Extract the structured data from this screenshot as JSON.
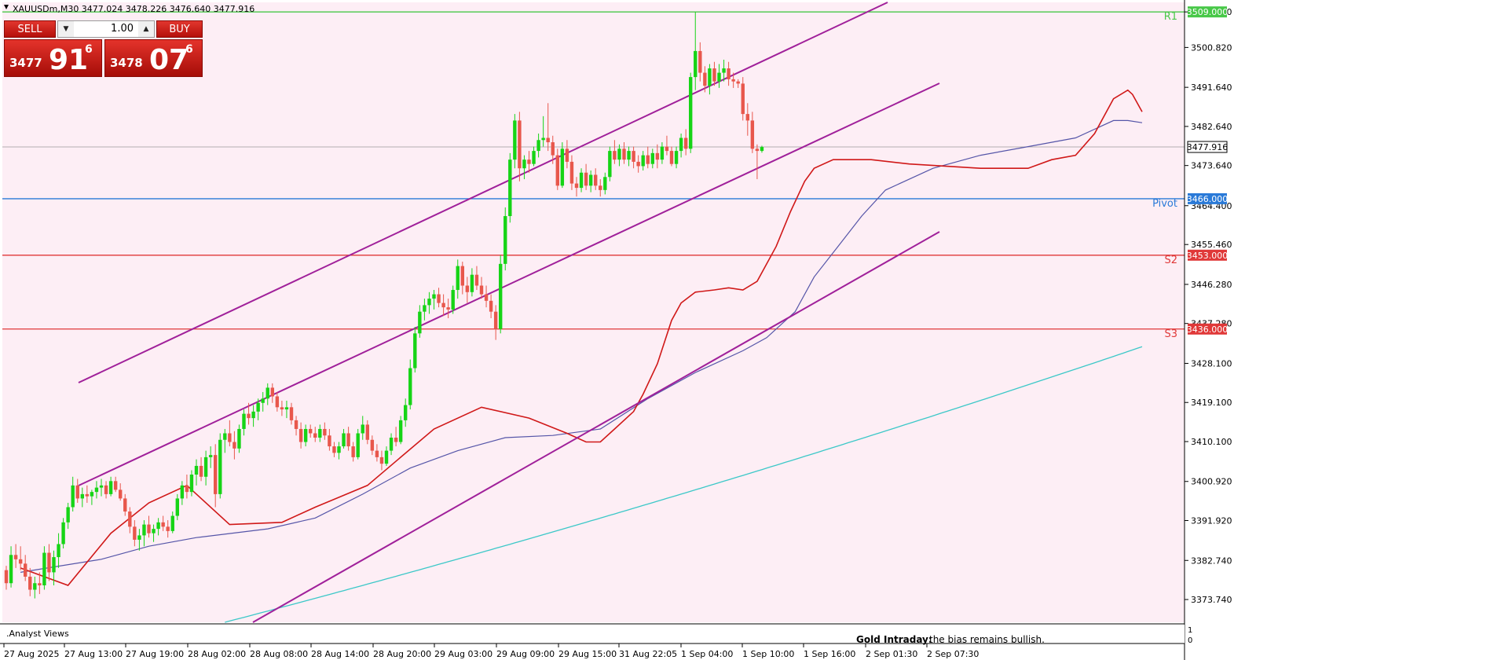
{
  "header": {
    "symbol_info": "XAUUSDm,M30  3477.024 3478.226 3476.640 3477.916"
  },
  "trade_panel": {
    "sell_label": "SELL",
    "buy_label": "BUY",
    "lot": "1.00",
    "sell_price_prefix": "3477",
    "sell_price_big": "91",
    "sell_price_sup": "6",
    "buy_price_prefix": "3478",
    "buy_price_big": "07",
    "buy_price_sup": "6"
  },
  "colors": {
    "background": "#fdeef5",
    "bull": "#16d416",
    "bear": "#e8574c",
    "channel": "#a0209a",
    "ma_fast": "#d01818",
    "ma_mid": "#5555a8",
    "ma_slow": "#3cc8c8",
    "r1": "#48c848",
    "pivot": "#2a7ad8",
    "support": "#e03838",
    "current": "#9a9a9a"
  },
  "chart_data": {
    "type": "candlestick",
    "symbol": "XAUUSDm",
    "timeframe": "M30",
    "ylim": [
      3368.5,
      3511.2
    ],
    "price_ticks": [
      "3509.000",
      "3500.820",
      "3491.640",
      "3482.640",
      "3473.640",
      "3464.400",
      "3455.460",
      "3446.280",
      "3437.280",
      "3428.100",
      "3419.100",
      "3410.100",
      "3400.920",
      "3391.920",
      "3382.740",
      "3373.740"
    ],
    "time_labels": [
      "27 Aug 2025",
      "27 Aug 13:00",
      "27 Aug 19:00",
      "28 Aug 02:00",
      "28 Aug 08:00",
      "28 Aug 14:00",
      "28 Aug 20:00",
      "29 Aug 03:00",
      "29 Aug 09:00",
      "29 Aug 15:00",
      "31 Aug 22:05",
      "1 Sep 04:00",
      "1 Sep 10:00",
      "1 Sep 16:00",
      "2 Sep 01:30",
      "2 Sep 07:30"
    ],
    "levels": [
      {
        "name": "R1",
        "value": 3509.0,
        "label": "3509.000"
      },
      {
        "name": "Pivot",
        "value": 3466.0,
        "label": "3466.000"
      },
      {
        "name": "S2",
        "value": 3453.0,
        "label": "3453.000"
      },
      {
        "name": "S3",
        "value": 3436.0,
        "label": "3436.000"
      }
    ],
    "current_price": {
      "value": 3477.916,
      "label": "3477.916"
    },
    "candles": [
      [
        3380.5,
        3381.5,
        3376.0,
        3377.5
      ],
      [
        3377.5,
        3386.0,
        3376.5,
        3384.0
      ],
      [
        3384.0,
        3386.5,
        3381.0,
        3383.0
      ],
      [
        3383.0,
        3386.0,
        3380.5,
        3382.0
      ],
      [
        3382.0,
        3384.0,
        3378.0,
        3379.0
      ],
      [
        3379.0,
        3381.0,
        3374.5,
        3376.0
      ],
      [
        3376.0,
        3379.0,
        3374.0,
        3377.5
      ],
      [
        3377.5,
        3380.0,
        3375.0,
        3377.0
      ],
      [
        3377.0,
        3386.0,
        3376.0,
        3384.5
      ],
      [
        3384.5,
        3386.5,
        3378.0,
        3380.0
      ],
      [
        3380.0,
        3385.0,
        3377.0,
        3383.5
      ],
      [
        3383.5,
        3389.0,
        3381.0,
        3386.5
      ],
      [
        3386.5,
        3392.5,
        3385.5,
        3391.5
      ],
      [
        3391.5,
        3396.0,
        3390.0,
        3395.0
      ],
      [
        3395.0,
        3402.0,
        3394.0,
        3400.0
      ],
      [
        3400.0,
        3401.5,
        3396.0,
        3397.0
      ],
      [
        3397.0,
        3399.5,
        3395.0,
        3398.0
      ],
      [
        3398.0,
        3400.0,
        3396.0,
        3397.5
      ],
      [
        3397.5,
        3399.0,
        3395.5,
        3398.5
      ],
      [
        3398.5,
        3401.0,
        3397.0,
        3399.5
      ],
      [
        3399.5,
        3401.5,
        3397.5,
        3400.0
      ],
      [
        3400.0,
        3401.0,
        3397.0,
        3398.0
      ],
      [
        3398.0,
        3402.0,
        3397.5,
        3401.0
      ],
      [
        3401.0,
        3402.0,
        3398.5,
        3399.0
      ],
      [
        3399.0,
        3400.5,
        3396.5,
        3397.0
      ],
      [
        3397.0,
        3398.0,
        3393.0,
        3394.0
      ],
      [
        3394.0,
        3395.0,
        3389.0,
        3390.5
      ],
      [
        3390.5,
        3392.0,
        3386.0,
        3387.5
      ],
      [
        3387.5,
        3390.0,
        3385.0,
        3388.5
      ],
      [
        3388.5,
        3392.0,
        3386.0,
        3391.0
      ],
      [
        3391.0,
        3393.0,
        3388.0,
        3389.0
      ],
      [
        3389.0,
        3391.0,
        3387.0,
        3390.0
      ],
      [
        3390.0,
        3392.5,
        3388.5,
        3391.5
      ],
      [
        3391.5,
        3393.0,
        3389.5,
        3390.5
      ],
      [
        3390.5,
        3392.0,
        3388.0,
        3389.5
      ],
      [
        3389.5,
        3394.0,
        3389.0,
        3393.0
      ],
      [
        3393.0,
        3398.0,
        3392.0,
        3397.0
      ],
      [
        3397.0,
        3401.0,
        3395.5,
        3400.0
      ],
      [
        3400.0,
        3402.5,
        3397.0,
        3398.5
      ],
      [
        3398.5,
        3403.5,
        3397.5,
        3402.5
      ],
      [
        3402.5,
        3406.0,
        3400.0,
        3404.5
      ],
      [
        3404.5,
        3406.5,
        3401.0,
        3402.0
      ],
      [
        3402.0,
        3408.0,
        3400.0,
        3406.5
      ],
      [
        3406.5,
        3409.0,
        3404.0,
        3407.0
      ],
      [
        3407.0,
        3409.5,
        3395.0,
        3398.0
      ],
      [
        3398.0,
        3412.0,
        3397.0,
        3410.5
      ],
      [
        3410.5,
        3413.0,
        3407.5,
        3412.0
      ],
      [
        3412.0,
        3415.0,
        3409.0,
        3410.0
      ],
      [
        3410.0,
        3412.5,
        3406.0,
        3408.5
      ],
      [
        3408.5,
        3414.0,
        3407.5,
        3413.0
      ],
      [
        3413.0,
        3417.5,
        3411.5,
        3416.5
      ],
      [
        3416.5,
        3419.0,
        3414.0,
        3415.5
      ],
      [
        3415.5,
        3418.5,
        3413.5,
        3417.0
      ],
      [
        3417.0,
        3420.0,
        3415.0,
        3419.0
      ],
      [
        3419.0,
        3421.5,
        3417.0,
        3420.0
      ],
      [
        3420.0,
        3423.5,
        3418.5,
        3422.5
      ],
      [
        3422.5,
        3423.5,
        3419.0,
        3420.5
      ],
      [
        3420.5,
        3421.5,
        3417.0,
        3418.0
      ],
      [
        3418.0,
        3419.5,
        3416.0,
        3417.5
      ],
      [
        3417.5,
        3419.5,
        3415.5,
        3418.0
      ],
      [
        3418.0,
        3419.0,
        3414.0,
        3415.0
      ],
      [
        3415.0,
        3416.0,
        3411.5,
        3413.0
      ],
      [
        3413.0,
        3414.5,
        3408.5,
        3410.0
      ],
      [
        3410.0,
        3414.0,
        3409.0,
        3413.0
      ],
      [
        3413.0,
        3414.0,
        3411.0,
        3412.0
      ],
      [
        3412.0,
        3413.5,
        3410.0,
        3411.0
      ],
      [
        3411.0,
        3414.0,
        3410.0,
        3413.0
      ],
      [
        3413.0,
        3414.5,
        3410.5,
        3411.5
      ],
      [
        3411.5,
        3413.0,
        3408.0,
        3409.0
      ],
      [
        3409.0,
        3410.0,
        3406.5,
        3407.5
      ],
      [
        3407.5,
        3410.0,
        3406.0,
        3409.0
      ],
      [
        3409.0,
        3413.0,
        3408.5,
        3412.0
      ],
      [
        3412.0,
        3413.5,
        3408.0,
        3409.0
      ],
      [
        3409.0,
        3410.0,
        3405.5,
        3406.5
      ],
      [
        3406.5,
        3413.0,
        3406.0,
        3412.0
      ],
      [
        3412.0,
        3416.0,
        3410.5,
        3414.0
      ],
      [
        3414.0,
        3415.0,
        3409.5,
        3410.5
      ],
      [
        3410.5,
        3411.5,
        3407.0,
        3408.0
      ],
      [
        3408.0,
        3409.5,
        3405.5,
        3406.5
      ],
      [
        3406.5,
        3408.0,
        3403.5,
        3405.0
      ],
      [
        3405.0,
        3409.0,
        3404.5,
        3408.0
      ],
      [
        3408.0,
        3412.0,
        3407.0,
        3411.0
      ],
      [
        3411.0,
        3413.5,
        3409.0,
        3410.0
      ],
      [
        3410.0,
        3416.0,
        3409.5,
        3415.0
      ],
      [
        3415.0,
        3420.0,
        3413.5,
        3418.5
      ],
      [
        3418.5,
        3429.0,
        3417.5,
        3427.0
      ],
      [
        3427.0,
        3436.5,
        3426.0,
        3435.0
      ],
      [
        3435.0,
        3441.5,
        3434.0,
        3440.0
      ],
      [
        3440.0,
        3443.0,
        3438.0,
        3441.5
      ],
      [
        3441.5,
        3444.5,
        3439.5,
        3443.0
      ],
      [
        3443.0,
        3445.0,
        3440.5,
        3444.0
      ],
      [
        3444.0,
        3445.5,
        3441.0,
        3442.0
      ],
      [
        3442.0,
        3444.0,
        3439.0,
        3441.0
      ],
      [
        3441.0,
        3443.0,
        3438.5,
        3440.5
      ],
      [
        3440.5,
        3446.0,
        3439.5,
        3445.0
      ],
      [
        3445.0,
        3452.0,
        3443.0,
        3450.5
      ],
      [
        3450.5,
        3451.5,
        3444.0,
        3446.0
      ],
      [
        3446.0,
        3448.0,
        3442.0,
        3444.5
      ],
      [
        3444.5,
        3450.0,
        3443.5,
        3448.5
      ],
      [
        3448.5,
        3450.5,
        3445.0,
        3446.0
      ],
      [
        3446.0,
        3448.0,
        3443.0,
        3444.0
      ],
      [
        3444.0,
        3446.0,
        3441.0,
        3442.5
      ],
      [
        3442.5,
        3444.0,
        3438.5,
        3440.0
      ],
      [
        3440.0,
        3441.5,
        3433.5,
        3436.0
      ],
      [
        3436.0,
        3453.0,
        3435.0,
        3451.0
      ],
      [
        3451.0,
        3464.0,
        3449.5,
        3462.0
      ],
      [
        3462.0,
        3476.5,
        3460.5,
        3475.0
      ],
      [
        3475.0,
        3485.5,
        3473.0,
        3484.0
      ],
      [
        3484.0,
        3486.0,
        3470.0,
        3473.0
      ],
      [
        3473.0,
        3476.0,
        3470.5,
        3475.0
      ],
      [
        3475.0,
        3477.0,
        3472.0,
        3474.0
      ],
      [
        3474.0,
        3478.0,
        3473.5,
        3477.0
      ],
      [
        3477.0,
        3481.0,
        3475.5,
        3479.5
      ],
      [
        3479.5,
        3485.0,
        3478.0,
        3480.0
      ],
      [
        3480.0,
        3488.0,
        3477.0,
        3479.0
      ],
      [
        3479.0,
        3480.5,
        3474.0,
        3476.0
      ],
      [
        3476.0,
        3477.5,
        3468.0,
        3469.0
      ],
      [
        3469.0,
        3479.0,
        3468.5,
        3477.5
      ],
      [
        3477.5,
        3479.5,
        3473.0,
        3474.5
      ],
      [
        3474.5,
        3476.0,
        3468.0,
        3469.5
      ],
      [
        3469.5,
        3471.0,
        3466.5,
        3468.5
      ],
      [
        3468.5,
        3473.0,
        3467.5,
        3472.0
      ],
      [
        3472.0,
        3474.0,
        3468.0,
        3469.0
      ],
      [
        3469.0,
        3472.5,
        3467.5,
        3471.5
      ],
      [
        3471.5,
        3473.0,
        3468.0,
        3469.0
      ],
      [
        3469.0,
        3470.5,
        3466.5,
        3468.0
      ],
      [
        3468.0,
        3472.0,
        3467.0,
        3471.0
      ],
      [
        3471.0,
        3478.0,
        3470.0,
        3477.0
      ],
      [
        3477.0,
        3479.5,
        3474.0,
        3475.0
      ],
      [
        3475.0,
        3478.5,
        3473.5,
        3477.5
      ],
      [
        3477.5,
        3479.0,
        3474.0,
        3475.0
      ],
      [
        3475.0,
        3478.0,
        3473.5,
        3477.0
      ],
      [
        3477.0,
        3478.0,
        3473.0,
        3474.5
      ],
      [
        3474.5,
        3476.0,
        3472.0,
        3473.5
      ],
      [
        3473.5,
        3477.0,
        3472.5,
        3476.0
      ],
      [
        3476.0,
        3478.0,
        3473.0,
        3474.0
      ],
      [
        3474.0,
        3477.5,
        3473.0,
        3476.5
      ],
      [
        3476.5,
        3478.5,
        3473.0,
        3475.0
      ],
      [
        3475.0,
        3479.0,
        3474.0,
        3478.0
      ],
      [
        3478.0,
        3480.5,
        3476.0,
        3477.0
      ],
      [
        3477.0,
        3478.0,
        3473.5,
        3474.0
      ],
      [
        3474.0,
        3478.0,
        3473.0,
        3477.0
      ],
      [
        3477.0,
        3481.0,
        3475.5,
        3480.0
      ],
      [
        3480.0,
        3482.0,
        3476.0,
        3477.5
      ],
      [
        3477.5,
        3495.0,
        3476.5,
        3494.0
      ],
      [
        3494.0,
        3509.0,
        3491.0,
        3500.0
      ],
      [
        3500.0,
        3502.0,
        3493.0,
        3495.0
      ],
      [
        3495.0,
        3496.5,
        3490.5,
        3492.0
      ],
      [
        3492.0,
        3497.0,
        3490.0,
        3496.0
      ],
      [
        3496.0,
        3497.5,
        3492.0,
        3493.0
      ],
      [
        3493.0,
        3497.0,
        3491.5,
        3495.0
      ],
      [
        3495.0,
        3498.0,
        3493.0,
        3496.0
      ],
      [
        3496.0,
        3497.5,
        3492.0,
        3493.5
      ],
      [
        3493.5,
        3495.0,
        3491.5,
        3493.0
      ],
      [
        3493.0,
        3493.5,
        3491.5,
        3492.5
      ],
      [
        3492.5,
        3494.0,
        3484.0,
        3485.5
      ],
      [
        3485.5,
        3488.0,
        3480.5,
        3484.0
      ],
      [
        3484.0,
        3486.0,
        3476.5,
        3477.5
      ],
      [
        3477.5,
        3478.5,
        3470.5,
        3477.0
      ],
      [
        3477.0,
        3478.2,
        3476.6,
        3477.9
      ]
    ],
    "ma_fast": [
      [
        3,
        3381
      ],
      [
        13,
        3377
      ],
      [
        22,
        3389
      ],
      [
        30,
        3396
      ],
      [
        38,
        3400
      ],
      [
        47,
        3391
      ],
      [
        58,
        3391.5
      ],
      [
        65,
        3395
      ],
      [
        76,
        3400
      ],
      [
        90,
        3413
      ],
      [
        100,
        3418
      ],
      [
        110,
        3415.5
      ],
      [
        118,
        3412
      ],
      [
        122,
        3410
      ],
      [
        125,
        3410
      ],
      [
        128,
        3413
      ],
      [
        132,
        3417
      ],
      [
        134,
        3421
      ],
      [
        137,
        3428
      ],
      [
        140,
        3438
      ],
      [
        142,
        3442
      ],
      [
        145,
        3444.5
      ],
      [
        149,
        3445
      ],
      [
        152,
        3445.5
      ],
      [
        155,
        3445
      ],
      [
        158,
        3447
      ],
      [
        162,
        3455
      ],
      [
        165,
        3463
      ],
      [
        168,
        3470
      ],
      [
        170,
        3473
      ],
      [
        174,
        3475
      ],
      [
        182,
        3475
      ],
      [
        190,
        3474
      ],
      [
        205,
        3473
      ],
      [
        215,
        3473
      ],
      [
        220,
        3475
      ],
      [
        225,
        3476
      ],
      [
        229,
        3481
      ],
      [
        233,
        3489
      ],
      [
        236,
        3491
      ],
      [
        237,
        3490
      ],
      [
        239,
        3486
      ]
    ],
    "ma_mid": [
      [
        3,
        3380
      ],
      [
        20,
        3383
      ],
      [
        30,
        3386
      ],
      [
        40,
        3388
      ],
      [
        55,
        3390
      ],
      [
        65,
        3392.5
      ],
      [
        75,
        3398
      ],
      [
        85,
        3404
      ],
      [
        95,
        3408
      ],
      [
        105,
        3411
      ],
      [
        115,
        3411.5
      ],
      [
        125,
        3413
      ],
      [
        135,
        3420
      ],
      [
        145,
        3426
      ],
      [
        155,
        3431
      ],
      [
        160,
        3434
      ],
      [
        166,
        3440
      ],
      [
        170,
        3448
      ],
      [
        175,
        3455
      ],
      [
        180,
        3462
      ],
      [
        185,
        3468
      ],
      [
        195,
        3473
      ],
      [
        205,
        3476
      ],
      [
        215,
        3478
      ],
      [
        225,
        3480
      ],
      [
        233,
        3484
      ],
      [
        236,
        3484
      ],
      [
        239,
        3483.5
      ]
    ]
  }
}
